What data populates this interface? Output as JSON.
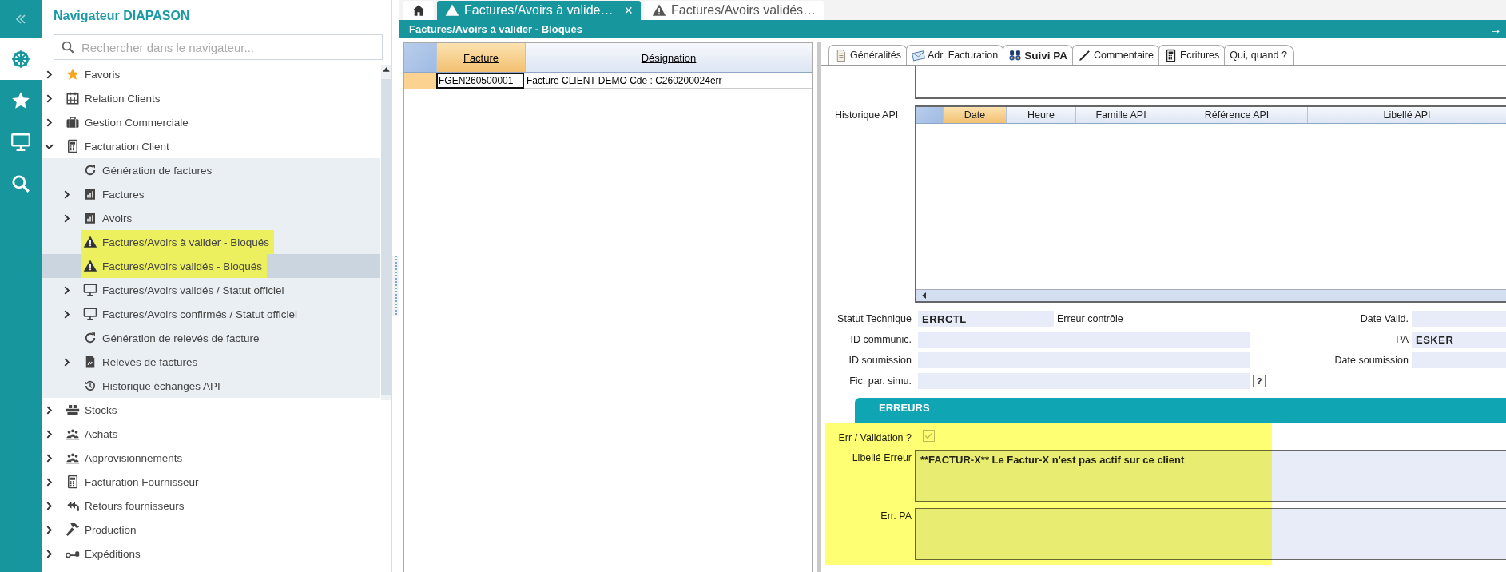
{
  "rail": {
    "items": [
      {
        "kind": "wheel",
        "selected": true
      },
      {
        "kind": "star",
        "selected": false
      },
      {
        "kind": "monitor",
        "selected": false
      },
      {
        "kind": "search",
        "selected": false
      }
    ]
  },
  "navigator": {
    "title": "Navigateur DIAPASON",
    "search": {
      "placeholder": "Rechercher dans le navigateur..."
    },
    "items": [
      {
        "label": "Favoris",
        "kind": "star",
        "expandable": true,
        "expanded": false,
        "selected": false,
        "highlighted": false
      },
      {
        "label": "Relation Clients",
        "kind": "calendar",
        "expandable": true,
        "expanded": false,
        "selected": false,
        "highlighted": false
      },
      {
        "label": "Gestion Commerciale",
        "kind": "briefcase",
        "expandable": true,
        "expanded": false,
        "selected": false,
        "highlighted": false
      },
      {
        "label": "Facturation Client",
        "kind": "calculator",
        "expandable": true,
        "expanded": true,
        "selected": false,
        "highlighted": false,
        "children": [
          {
            "label": "Génération de factures",
            "kind": "refresh",
            "expandable": false,
            "selected": false,
            "highlighted": false
          },
          {
            "label": "Factures",
            "kind": "report",
            "expandable": true,
            "expanded": false,
            "selected": false,
            "highlighted": false
          },
          {
            "label": "Avoirs",
            "kind": "report",
            "expandable": true,
            "expanded": false,
            "selected": false,
            "highlighted": false
          },
          {
            "label": "Factures/Avoirs à valider - Bloqués",
            "kind": "warning",
            "expandable": false,
            "selected": false,
            "highlighted": true
          },
          {
            "label": "Factures/Avoirs validés - Bloqués",
            "kind": "warning",
            "expandable": false,
            "selected": true,
            "highlighted": true
          },
          {
            "label": "Factures/Avoirs validés / Statut officiel",
            "kind": "monitor",
            "expandable": true,
            "expanded": false,
            "selected": false,
            "highlighted": false
          },
          {
            "label": "Factures/Avoirs confirmés / Statut officiel",
            "kind": "monitor",
            "expandable": true,
            "expanded": false,
            "selected": false,
            "highlighted": false
          },
          {
            "label": "Génération de relevés de facture",
            "kind": "refresh",
            "expandable": false,
            "selected": false,
            "highlighted": false
          },
          {
            "label": "Relevés de factures",
            "kind": "file",
            "expandable": true,
            "expanded": false,
            "selected": false,
            "highlighted": false
          },
          {
            "label": "Historique échanges API",
            "kind": "history",
            "expandable": false,
            "selected": false,
            "highlighted": false
          }
        ]
      },
      {
        "label": "Stocks",
        "kind": "boxes",
        "expandable": true,
        "expanded": false,
        "selected": false,
        "highlighted": false
      },
      {
        "label": "Achats",
        "kind": "people",
        "expandable": true,
        "expanded": false,
        "selected": false,
        "highlighted": false
      },
      {
        "label": "Approvisionnements",
        "kind": "people",
        "expandable": true,
        "expanded": false,
        "selected": false,
        "highlighted": false
      },
      {
        "label": "Facturation Fournisseur",
        "kind": "calculator",
        "expandable": true,
        "expanded": false,
        "selected": false,
        "highlighted": false
      },
      {
        "label": "Retours fournisseurs",
        "kind": "return",
        "expandable": true,
        "expanded": false,
        "selected": false,
        "highlighted": false
      },
      {
        "label": "Production",
        "kind": "hammer",
        "expandable": true,
        "expanded": false,
        "selected": false,
        "highlighted": false
      },
      {
        "label": "Expéditions",
        "kind": "key",
        "expandable": true,
        "expanded": false,
        "selected": false,
        "highlighted": false
      }
    ]
  },
  "tabs": [
    {
      "kind": "home",
      "selected": false
    },
    {
      "kind": "page",
      "label": "Factures/Avoirs  à  valide…",
      "close": "×",
      "selected": true
    },
    {
      "kind": "page",
      "label": "Factures/Avoirs  validés…",
      "selected": false
    }
  ],
  "header": {
    "title": "Factures/Avoirs à valider - Bloqués",
    "action": "→"
  },
  "list": {
    "columns": [
      {
        "label": "Facture",
        "sorted": true
      },
      {
        "label": "Désignation",
        "sorted": false
      }
    ],
    "rows": [
      {
        "cells": [
          "FGEN260500001",
          "Facture CLIENT DEMO  Cde : C260200024err"
        ],
        "selected": true
      }
    ]
  },
  "detail": {
    "tabs": [
      {
        "label": "Généralités",
        "kind": "document",
        "selected": false
      },
      {
        "label": "Adr. Facturation",
        "kind": "envelope",
        "selected": false
      },
      {
        "label": "Suivi PA",
        "kind": "binoculars",
        "selected": true
      },
      {
        "label": "Commentaire",
        "kind": "pen",
        "selected": false
      },
      {
        "label": "Ecritures",
        "kind": "calculator",
        "selected": false
      },
      {
        "label": "Qui, quand ?",
        "kind": "plain",
        "selected": false
      }
    ],
    "history": {
      "label": "Historique API",
      "columns": [
        {
          "label": "Date",
          "sorted": true
        },
        {
          "label": "Heure",
          "sorted": false
        },
        {
          "label": "Famille API",
          "sorted": false
        },
        {
          "label": "Référence API",
          "sorted": false
        },
        {
          "label": "Libellé API",
          "sorted": false
        }
      ]
    },
    "fields": [
      {
        "kind": "status",
        "label": "Statut Technique",
        "value": "ERRCTL",
        "note": "Erreur contrôle",
        "side_label": "Date Valid."
      },
      {
        "kind": "wide",
        "label": "ID communic.",
        "side_label": "PA",
        "side_value": "ESKER"
      },
      {
        "kind": "wide",
        "label": "ID soumission",
        "side_label": "Date soumission"
      },
      {
        "kind": "help",
        "label": "Fic. par. simu.",
        "help": "?"
      }
    ],
    "errors": {
      "title": "ERREURS",
      "highlighted": true,
      "validation": {
        "label": "Err / Validation ?",
        "checked": true,
        "disabled": true
      },
      "message": {
        "label": "Libellé Erreur",
        "value": "**FACTUR-X** Le Factur-X n'est pas actif sur ce client"
      },
      "pa": {
        "label": "Err. PA"
      }
    }
  }
}
